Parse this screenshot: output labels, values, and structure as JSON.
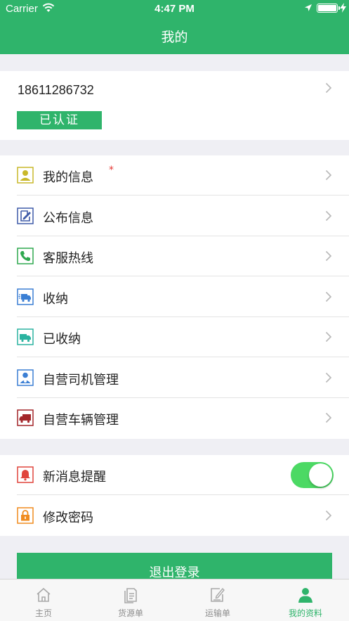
{
  "status_bar": {
    "carrier": "Carrier",
    "time": "4:47 PM"
  },
  "header": {
    "title": "我的"
  },
  "account": {
    "phone": "18611286732",
    "verified_badge": "已认证"
  },
  "menu_items": [
    {
      "label": "我的信息",
      "icon": "user-card-icon",
      "color": "#c9b82a",
      "marker": "*"
    },
    {
      "label": "公布信息",
      "icon": "edit-document-icon",
      "color": "#3f5aa8"
    },
    {
      "label": "客服热线",
      "icon": "phone-icon",
      "color": "#2fa84f"
    },
    {
      "label": "收纳",
      "icon": "delivery-truck-icon",
      "color": "#3b7fd4"
    },
    {
      "label": "已收纳",
      "icon": "truck-icon",
      "color": "#2bb3a0"
    },
    {
      "label": "自营司机管理",
      "icon": "driver-icon",
      "color": "#3b7fd4"
    },
    {
      "label": "自营车辆管理",
      "icon": "vehicle-icon",
      "color": "#a3262a"
    }
  ],
  "settings": [
    {
      "label": "新消息提醒",
      "icon": "bell-icon",
      "color": "#e0453d",
      "toggle_on": true
    },
    {
      "label": "修改密码",
      "icon": "lock-icon",
      "color": "#f08c1f"
    }
  ],
  "logout_label": "退出登录",
  "tabs": [
    {
      "label": "主页",
      "icon": "home-icon",
      "active": false
    },
    {
      "label": "货源单",
      "icon": "document-list-icon",
      "active": false
    },
    {
      "label": "运输单",
      "icon": "edit-note-icon",
      "active": false
    },
    {
      "label": "我的资料",
      "icon": "profile-icon",
      "active": true
    }
  ],
  "colors": {
    "brand": "#2fb46b",
    "toggle_on": "#4cd964",
    "background": "#efeff4"
  }
}
